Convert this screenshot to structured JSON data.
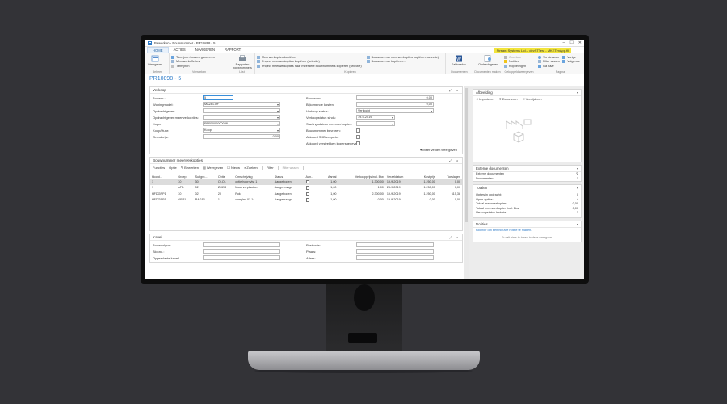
{
  "window": {
    "title": "Bewerken - Bouwnummer - PR10898 - 5"
  },
  "menu": {
    "tabs": [
      "HOME",
      "ACTIES",
      "NAVIGEREN",
      "RAPPORT"
    ],
    "active": "HOME",
    "company": "Stream Systems Ltd. - devSTTest - MKETimApp.fil"
  },
  "ribbon": {
    "beheer": {
      "name": "Beheer",
      "weergeven": "Weergeven"
    },
    "verwerken": {
      "name": "Verwerken",
      "items": [
        "Termijnen bouwn. genereren",
        "Meerwerkoffertes",
        "Termijnen"
      ]
    },
    "lijst": {
      "name": "Lijst",
      "rapport": "Rapporten bouwnummers"
    },
    "kopieren": {
      "name": "Kopiëren",
      "items_left": [
        "Meerwerkopties kopiëren",
        "Project meerwerkopties kopiëren (selectie)",
        "Project meerwerkopties naar meerdere bouwnummers kopiëren (selectie)"
      ],
      "items_right": [
        "Bouwnummer meerwerkopties kopiëren (selectie)",
        "Bouwnummer kopiëren..."
      ]
    },
    "documenten": {
      "name": "Documenten",
      "label": "Fakturadoc"
    },
    "documenten_maken": {
      "name": "Documenten maken",
      "label": "Opdrachtgever"
    },
    "gekoppeld": {
      "name": "Gekoppeld weergeven",
      "items": [
        "OneNote",
        "Notities",
        "Koppelingen"
      ]
    },
    "pagina": {
      "name": "Pagina",
      "items": [
        "Vernieuwen",
        "Filter wissen",
        "Ga naar",
        "Vorige",
        "Volgende"
      ]
    }
  },
  "page": {
    "title": "PR10898 - 5"
  },
  "verkoop": {
    "title": "Verkoop",
    "left": [
      {
        "label": "Bouwnr.:",
        "value": "5",
        "kind": "focused"
      },
      {
        "label": "Woningmodel:",
        "value": "MAZELIJF",
        "kind": "dd"
      },
      {
        "label": "Opdrachtgever:",
        "value": "",
        "kind": "dd"
      },
      {
        "label": "Opdrachtgever meerwerkopties:",
        "value": "",
        "kind": "dd"
      },
      {
        "label": "Koper:",
        "value": "PER0000000038",
        "kind": "dd"
      },
      {
        "label": "Koop/Huur:",
        "value": "Koop",
        "kind": "dd"
      },
      {
        "label": "Grondprijs:",
        "value": "0,00",
        "kind": "right"
      }
    ],
    "right": [
      {
        "label": "Bouwsom:",
        "value": "0,00",
        "kind": "right"
      },
      {
        "label": "Bijkomende kosten:",
        "value": "0,00",
        "kind": "right"
      },
      {
        "label": "Verkoop status:",
        "value": "Verkocht",
        "kind": "dd"
      },
      {
        "label": "Verkoopstatus sinds:",
        "value": "19-9-2019",
        "kind": "date"
      },
      {
        "label": "Startingsdatum meerwerkopties:",
        "value": "",
        "kind": "date"
      },
      {
        "label": "Bouwnummer bevroren:",
        "value": "",
        "kind": "chk"
      },
      {
        "label": "Akkoord SKB enquete:",
        "value": "",
        "kind": "chk"
      },
      {
        "label": "Akkoord verstrekken kopersgegevens derden:",
        "value": "",
        "kind": "chk"
      }
    ],
    "show_more": "Meer velden weergeven"
  },
  "opties": {
    "title": "Bouwnummer meerwerkopties",
    "toolbar": [
      "Functies",
      "Optie",
      "Bewerken",
      "Weergeven",
      "Nieuw",
      "Zoeken",
      "Filter"
    ],
    "filter_placeholder": "Filter wissen",
    "columns": [
      "Hoofd...",
      "Groep",
      "Subgro...",
      "Optie",
      "Omschrijving",
      "Status",
      "Aan...",
      "Aantal",
      "Verkoopprijs incl. Btw",
      "Verzeldatum",
      "Kostprijs",
      "Toeslagen"
    ],
    "rows": [
      [
        "1",
        "30",
        "30",
        "O1O1",
        "optie hoornvlst 1",
        "Aangeboden",
        "",
        "1,00",
        "1.300,00",
        "19-9-2019",
        "1.250,00",
        "0,00"
      ],
      [
        "1",
        "AFB",
        "02",
        "ZO2I3",
        "Muur verplaatsen",
        "Aangevraagd",
        "",
        "1,00",
        "1,00",
        "23-9-2019",
        "1.250,00",
        "0,00"
      ],
      [
        "HFDGRP1",
        "30",
        "02",
        "20",
        "Rok",
        "Aangeboden",
        "",
        "1,00",
        "2.300,00",
        "19-9-2019",
        "1.250,00",
        "615,38"
      ],
      [
        "HFDGRP1",
        "GRP1",
        "RAGS1",
        "1",
        "complex 01-14",
        "Aangevraagd",
        "",
        "1,00",
        "0,00",
        "19-9-2019",
        "0,00",
        "0,00"
      ]
    ]
  },
  "kavel": {
    "title": "Kavel",
    "left": [
      {
        "label": "Bouwvolgnr.:",
        "value": ""
      },
      {
        "label": "Blokno.:",
        "value": ""
      },
      {
        "label": "Oppervlakte kavel:",
        "value": ""
      }
    ],
    "right": [
      {
        "label": "Postcode:",
        "value": ""
      },
      {
        "label": "Plaats:",
        "value": ""
      },
      {
        "label": "Adres:",
        "value": ""
      }
    ]
  },
  "factbox": {
    "afbeelding": {
      "title": "Afbeelding",
      "actions": [
        "Importeren",
        "Exporteren",
        "Verwijderen"
      ]
    },
    "externe": {
      "title": "Externe documenten",
      "rows": [
        {
          "label": "Externe documenten",
          "value": ""
        },
        {
          "label": "Documenten",
          "value": "1"
        }
      ]
    },
    "totalen": {
      "title": "Totalen",
      "rows": [
        {
          "label": "Opties in opdracht:",
          "value": "0"
        },
        {
          "label": "Open opties:",
          "value": "4"
        },
        {
          "label": "Totaal meerwerkopties:",
          "value": "0,00"
        },
        {
          "label": "Totaal meerwerkopties incl. Btw:",
          "value": "0,00"
        },
        {
          "label": "Verkoopstatus historie:",
          "value": "1"
        }
      ]
    },
    "notities": {
      "title": "Notities",
      "link": "Klik hier om een nieuwe notitie te maken.",
      "empty": "Er valt niets te tonen in deze weergave."
    }
  },
  "colors": {
    "accent": "#2d7bc8",
    "company_bg": "#f2e43a",
    "background": "#333337"
  }
}
